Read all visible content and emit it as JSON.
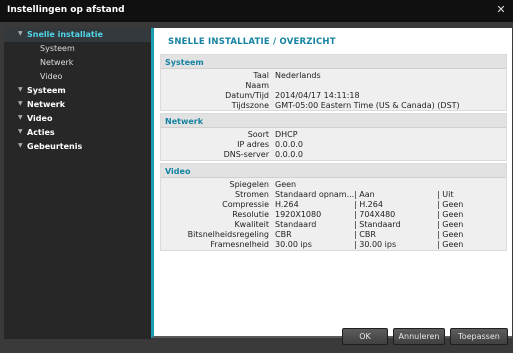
{
  "window": {
    "title": "Instellingen op afstand",
    "close_icon": "close-icon"
  },
  "sidebar": {
    "items": [
      {
        "label": "Snelle installatie",
        "active": true,
        "expanded": true
      },
      {
        "label": "Systeem",
        "sub": true
      },
      {
        "label": "Netwerk",
        "sub": true
      },
      {
        "label": "Video",
        "sub": true
      },
      {
        "label": "Systeem"
      },
      {
        "label": "Netwerk"
      },
      {
        "label": "Video"
      },
      {
        "label": "Acties"
      },
      {
        "label": "Gebeurtenis"
      }
    ]
  },
  "content": {
    "title": "SNELLE INSTALLATIE / OVERZICHT",
    "systeem": {
      "title": "Systeem",
      "rows": [
        {
          "key": "Taal",
          "value": "Nederlands"
        },
        {
          "key": "Naam",
          "value": ""
        },
        {
          "key": "Datum/Tijd",
          "value": "2014/04/17 14:11:18"
        },
        {
          "key": "Tijdszone",
          "value": "GMT-05:00 Eastern Time (US & Canada) (DST)"
        }
      ]
    },
    "netwerk": {
      "title": "Netwerk",
      "rows": [
        {
          "key": "Soort",
          "value": "DHCP"
        },
        {
          "key": "IP adres",
          "value": "0.0.0.0"
        },
        {
          "key": "DNS-server",
          "value": "0.0.0.0"
        }
      ]
    },
    "video": {
      "title": "Video",
      "rows": [
        {
          "key": "Spiegelen",
          "v1": "Geen",
          "v2": "",
          "v3": ""
        },
        {
          "key": "Stromen",
          "v1": "Standaard opnam...",
          "v2": "| Aan",
          "v3": "| Uit"
        },
        {
          "key": "Compressie",
          "v1": "H.264",
          "v2": "| H.264",
          "v3": "| Geen"
        },
        {
          "key": "Resolutie",
          "v1": "1920X1080",
          "v2": "| 704X480",
          "v3": "| Geen"
        },
        {
          "key": "Kwaliteit",
          "v1": "Standaard",
          "v2": "| Standaard",
          "v3": "| Geen"
        },
        {
          "key": "Bitsnelheidsregeling",
          "v1": "CBR",
          "v2": "| CBR",
          "v3": "| Geen"
        },
        {
          "key": "Framesnelheid",
          "v1": "30.00 ips",
          "v2": "| 30.00 ips",
          "v3": "| Geen"
        }
      ]
    }
  },
  "footer": {
    "ok_label": "OK",
    "cancel_label": "Annuleren",
    "apply_label": "Toepassen"
  }
}
